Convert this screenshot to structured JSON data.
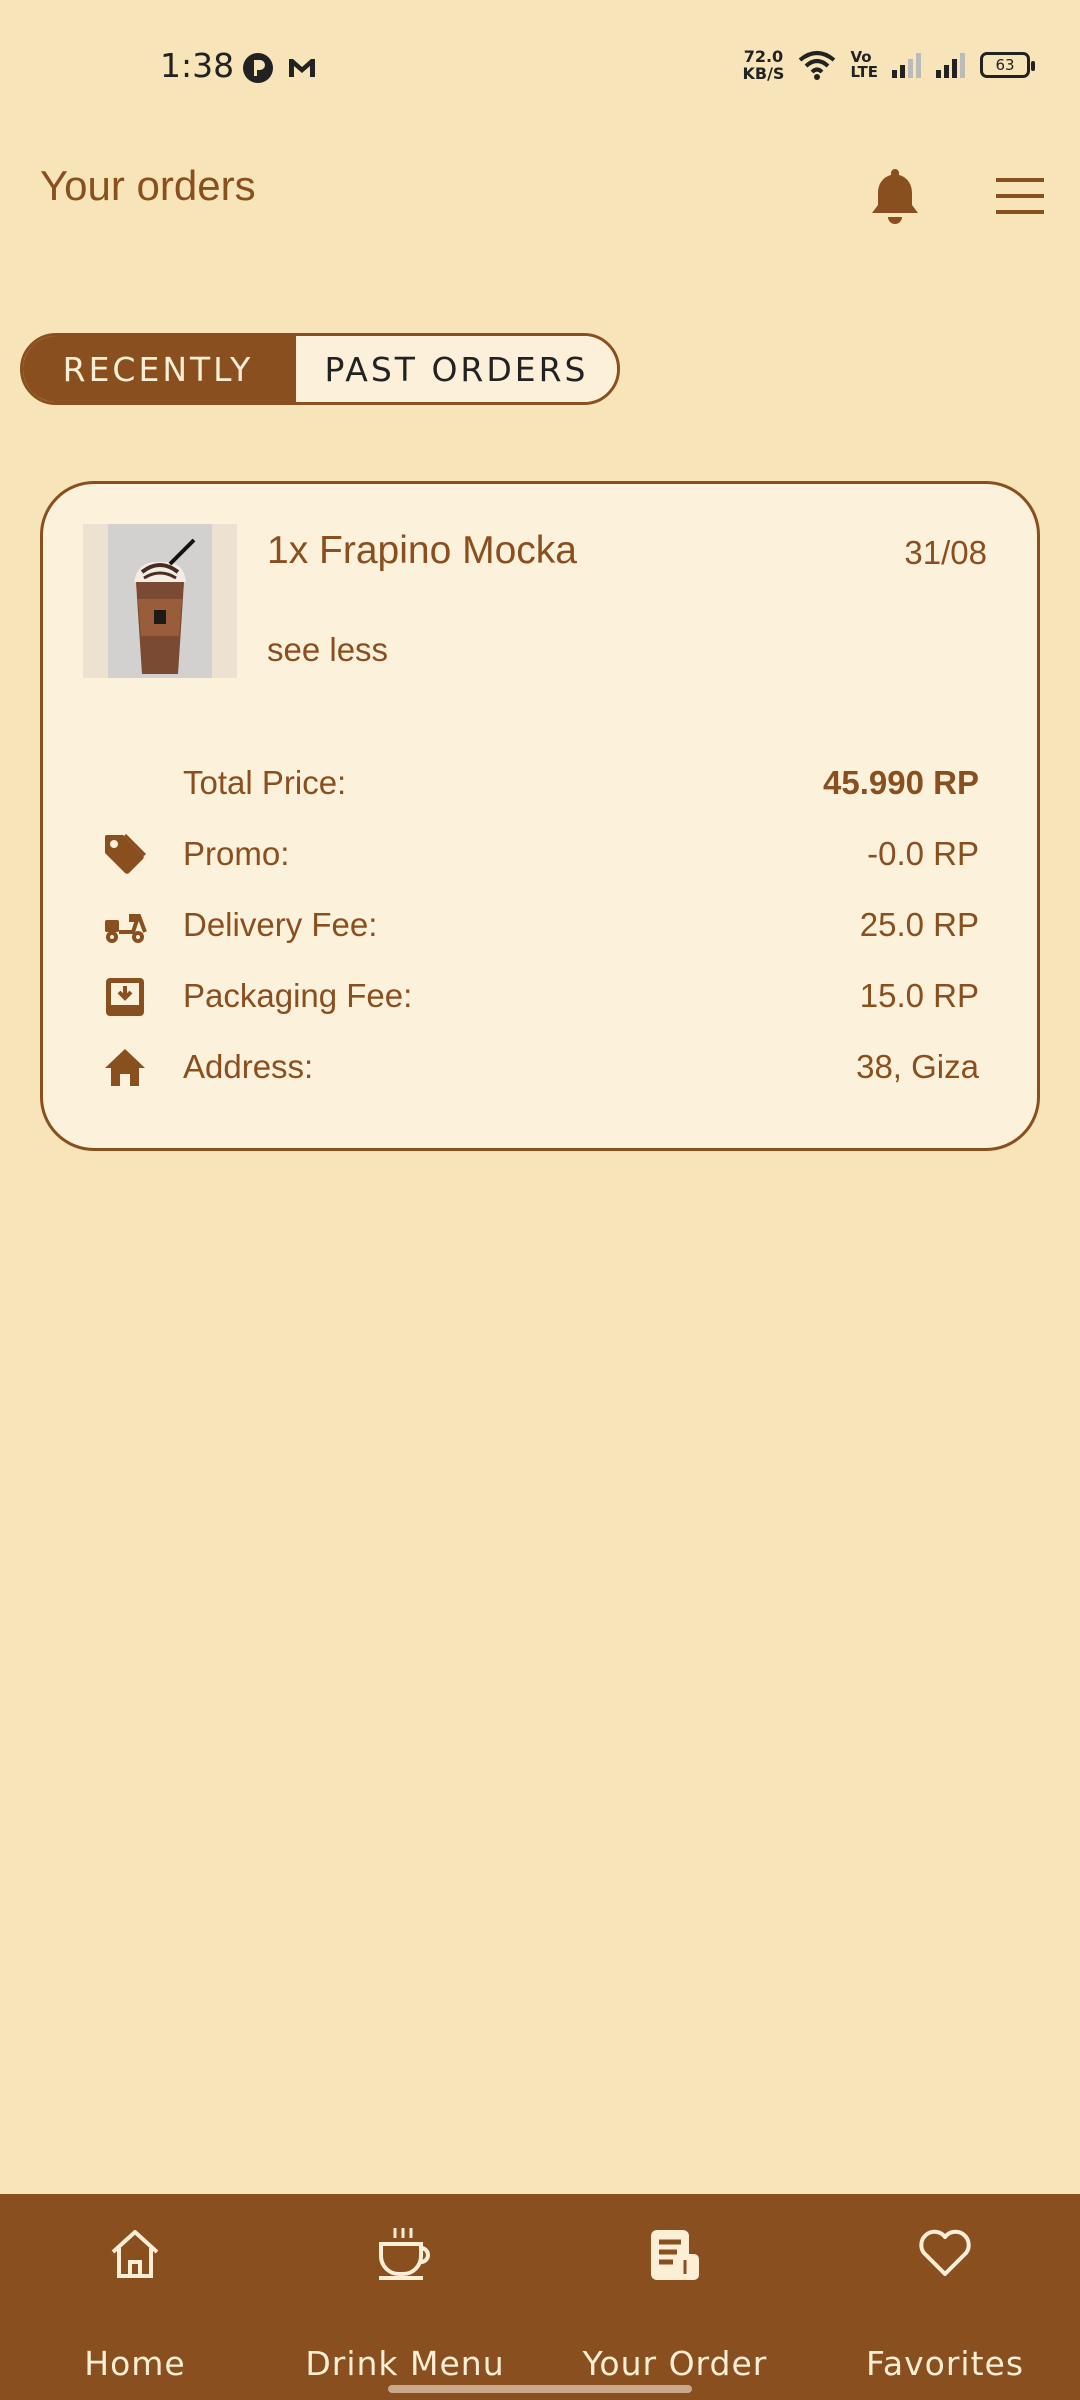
{
  "status_bar": {
    "time": "1:38",
    "network_speed_value": "72.0",
    "network_speed_unit": "KB/S",
    "volte_top": "Vo",
    "volte_bottom": "LTE",
    "battery": "63"
  },
  "header": {
    "title": "Your orders"
  },
  "tabs": {
    "recently": "RECENTLY",
    "past_orders": "PAST ORDERS"
  },
  "order": {
    "item_name": "1x Frapino Mocka",
    "date": "31/08",
    "toggle_label": "see less",
    "rows": [
      {
        "label": "Total Price:",
        "value": "45.990 RP",
        "icon": "none"
      },
      {
        "label": "Promo:",
        "value": "-0.0 RP",
        "icon": "tag-icon"
      },
      {
        "label": "Delivery Fee:",
        "value": "25.0 RP",
        "icon": "delivery-scooter-icon"
      },
      {
        "label": "Packaging Fee:",
        "value": "15.0 RP",
        "icon": "package-download-icon"
      },
      {
        "label": "Address:",
        "value": "38, Giza",
        "icon": "home-icon"
      }
    ]
  },
  "nav": {
    "items": [
      {
        "label": "Home",
        "icon": "home-outline-icon"
      },
      {
        "label": "Drink Menu",
        "icon": "coffee-cup-icon"
      },
      {
        "label": "Your Order",
        "icon": "receipt-icon"
      },
      {
        "label": "Favorites",
        "icon": "heart-outline-icon"
      }
    ]
  },
  "colors": {
    "background": "#F7E4B8",
    "card": "#FCF1DB",
    "primary": "#8A4F1F",
    "on_primary": "#FCEFD6"
  }
}
